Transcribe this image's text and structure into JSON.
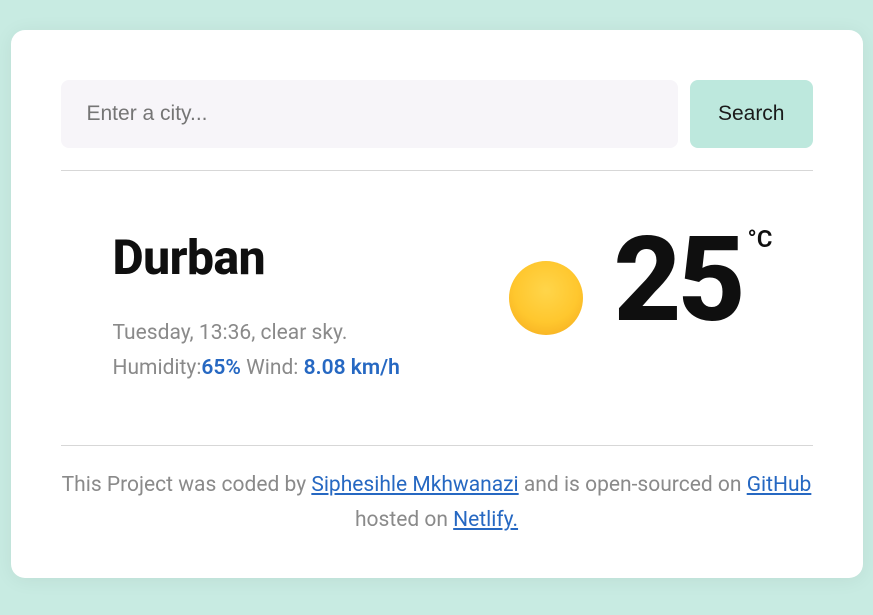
{
  "search": {
    "placeholder": "Enter a city...",
    "button_label": "Search"
  },
  "weather": {
    "city": "Durban",
    "day_time_desc": "Tuesday, 13:36, clear sky.",
    "humidity_label": "Humidity:",
    "humidity_value": "65%",
    "wind_label": " Wind: ",
    "wind_value": "8.08 km/h",
    "temperature": "25",
    "unit": "°C",
    "icon": "clear-sky-sun"
  },
  "footer": {
    "prefix": "This Project was coded by ",
    "author": "Siphesihle Mkhwanazi",
    "middle": " and is open-sourced on ",
    "repo": "GitHub",
    "hosted_prefix": "hosted on ",
    "host": "Netlify."
  }
}
